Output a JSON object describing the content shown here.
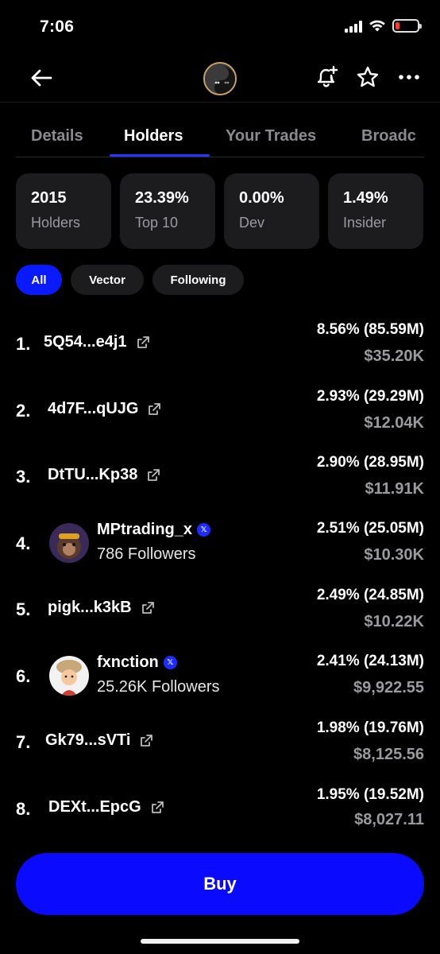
{
  "status_bar": {
    "time": "7:06",
    "battery_level": 0.2,
    "battery_color": "#ff3b30"
  },
  "nav": {
    "back_icon": "back-arrow-icon",
    "avatar_icon": "token-avatar-icon",
    "icons": [
      "bell-plus-icon",
      "star-icon",
      "more-icon"
    ]
  },
  "tabs": [
    {
      "label": "Details",
      "active": false
    },
    {
      "label": "Holders",
      "active": true
    },
    {
      "label": "Your Trades",
      "active": false
    },
    {
      "label": "Broadc",
      "active": false
    }
  ],
  "stats": [
    {
      "value": "2015",
      "label": "Holders"
    },
    {
      "value": "23.39%",
      "label": "Top 10"
    },
    {
      "value": "0.00%",
      "label": "Dev"
    },
    {
      "value": "1.49%",
      "label": "Insider"
    }
  ],
  "filters": [
    {
      "label": "All",
      "active": true
    },
    {
      "label": "Vector",
      "active": false
    },
    {
      "label": "Following",
      "active": false
    }
  ],
  "holders": [
    {
      "rank": "1.",
      "address": "5Q54...e4j1",
      "percent": "8.56% (85.59M)",
      "usd": "$35.20K"
    },
    {
      "rank": "2.",
      "address": "4d7F...qUJG",
      "percent": "2.93% (29.29M)",
      "usd": "$12.04K"
    },
    {
      "rank": "3.",
      "address": "DtTU...Kp38",
      "percent": "2.90% (28.95M)",
      "usd": "$11.91K"
    },
    {
      "rank": "4.",
      "username": "MPtrading_x",
      "followers": "786 Followers",
      "percent": "2.51% (25.05M)",
      "usd": "$10.30K"
    },
    {
      "rank": "5.",
      "address": "pigk...k3kB",
      "percent": "2.49% (24.85M)",
      "usd": "$10.22K"
    },
    {
      "rank": "6.",
      "username": "fxnction",
      "followers": "25.26K Followers",
      "percent": "2.41% (24.13M)",
      "usd": "$9,922.55"
    },
    {
      "rank": "7.",
      "address": "Gk79...sVTi",
      "percent": "1.98% (19.76M)",
      "usd": "$8,125.56"
    },
    {
      "rank": "8.",
      "address": "DEXt...EpcG",
      "percent": "1.95% (19.52M)",
      "usd": "$8,027.11"
    }
  ],
  "x_badge": "𝕏",
  "buy_label": "Buy",
  "colors": {
    "accent": "#0a0aff",
    "chip_active": "#0a1aff",
    "card_bg": "#1c1c1e",
    "muted": "#9a9a9f"
  }
}
